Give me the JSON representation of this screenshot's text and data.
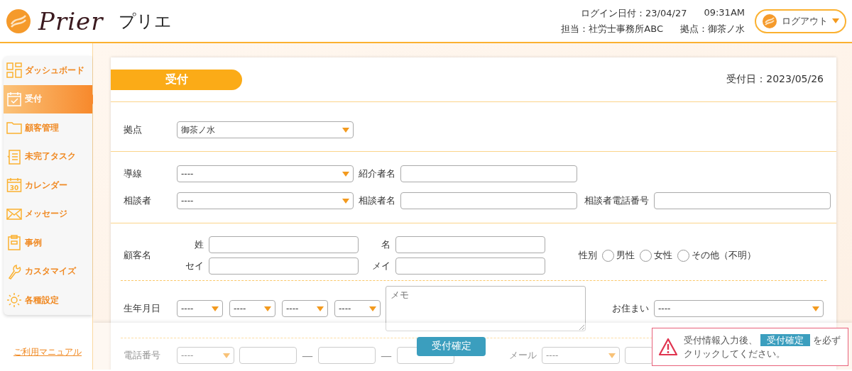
{
  "header": {
    "logo_text": "Prier",
    "app_name": "プリエ",
    "login_date": "ログイン日付：23/04/27",
    "login_time": "09:31AM",
    "staff": "担当：社労士事務所ABC",
    "branch": "拠点：御茶ノ水",
    "logout_button": "ログアウト"
  },
  "sidebar": {
    "items": [
      {
        "label": "ダッシュボード",
        "selected": false
      },
      {
        "label": "受付",
        "selected": true
      },
      {
        "label": "顧客管理",
        "selected": false
      },
      {
        "label": "未完了タスク",
        "selected": false
      },
      {
        "label": "カレンダー",
        "icon_label": "30",
        "selected": false
      },
      {
        "label": "メッセージ",
        "selected": false
      },
      {
        "label": "事例",
        "selected": false
      },
      {
        "label": "カスタマイズ",
        "selected": false
      },
      {
        "label": "各種設定",
        "selected": false
      }
    ],
    "manual_link": "ご利用マニュアル"
  },
  "form": {
    "title": "受付",
    "date": "受付日：2023/05/26",
    "branch": {
      "label": "拠点",
      "value": "御茶ノ水"
    },
    "route": {
      "label": "導線",
      "value": "----"
    },
    "referrer": {
      "label": "紹介者名"
    },
    "consultant": {
      "label": "相談者",
      "value": "----"
    },
    "consultant_name": {
      "label": "相談者名"
    },
    "consultant_phone": {
      "label": "相談者電話番号"
    },
    "customer_name": {
      "label": "顧客名",
      "last_name": "姓",
      "first_name": "名",
      "last_kana": "セイ",
      "first_kana": "メイ"
    },
    "gender": {
      "label": "性別",
      "options": [
        {
          "label": "男性",
          "selected": false
        },
        {
          "label": "女性",
          "selected": false
        },
        {
          "label": "その他（不明）",
          "selected": false
        }
      ]
    },
    "birthday": {
      "label": "生年月日",
      "selects": [
        "----",
        "----",
        "----",
        "----"
      ]
    },
    "memo": {
      "placeholder": "メモ"
    },
    "residence": {
      "label": "お住まい",
      "value": "----"
    },
    "phone": {
      "label": "電話番号",
      "value": "----",
      "separators": [
        "—",
        "—"
      ]
    },
    "email": {
      "label": "メール",
      "value": "----"
    }
  },
  "footer": {
    "confirm_button": "受付確定",
    "notice": {
      "before": "受付情報入力後、",
      "button_label": "受付確定",
      "after": "を必ずクリックしてください。"
    }
  }
}
